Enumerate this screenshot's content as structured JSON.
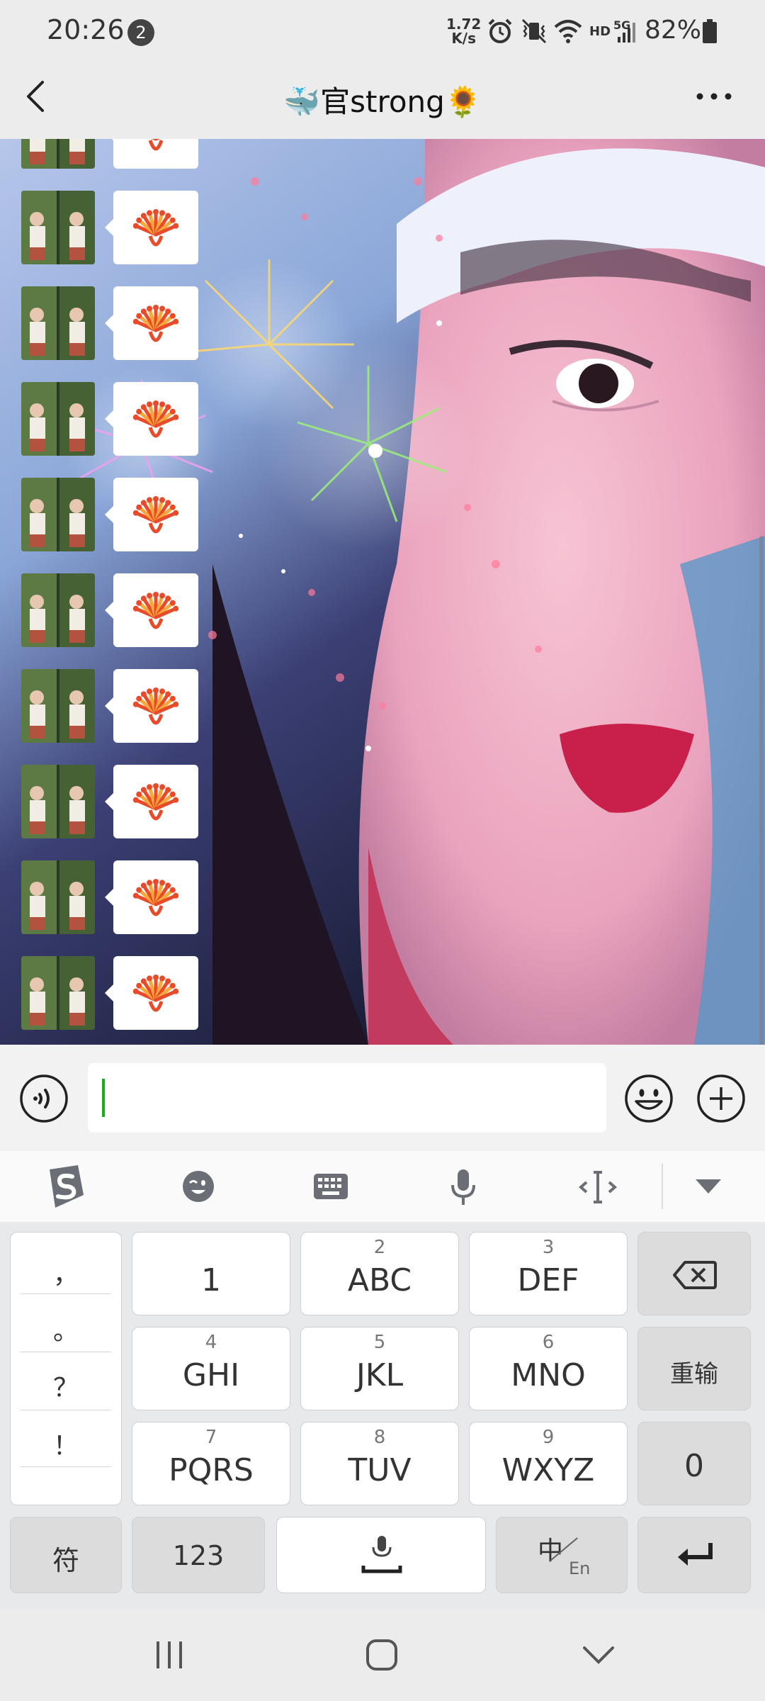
{
  "status_bar": {
    "time": "20:26",
    "notification_count": "2",
    "net_speed_value": "1.72",
    "net_speed_unit": "K/s",
    "hd_label": "HD",
    "fiveg_label": "5G",
    "battery": "82%"
  },
  "header": {
    "title": "🐳官strong🌻",
    "back_icon": "chevron-left-icon",
    "more_icon": "more-dots-icon"
  },
  "chat": {
    "messages": [
      {
        "sender": "contact",
        "content": "fireworks-emoji"
      },
      {
        "sender": "contact",
        "content": "fireworks-emoji"
      },
      {
        "sender": "contact",
        "content": "fireworks-emoji"
      },
      {
        "sender": "contact",
        "content": "fireworks-emoji"
      },
      {
        "sender": "contact",
        "content": "fireworks-emoji"
      },
      {
        "sender": "contact",
        "content": "fireworks-emoji"
      },
      {
        "sender": "contact",
        "content": "fireworks-emoji"
      },
      {
        "sender": "contact",
        "content": "fireworks-emoji"
      },
      {
        "sender": "contact",
        "content": "fireworks-emoji"
      },
      {
        "sender": "contact",
        "content": "fireworks-emoji"
      }
    ]
  },
  "input_bar": {
    "voice_icon": "voice-icon",
    "input_value": "",
    "emoji_icon": "smiley-icon",
    "plus_icon": "plus-icon"
  },
  "keyboard": {
    "toolbar_icons": [
      "sogou-logo-icon",
      "wink-emoji-icon",
      "keyboard-icon",
      "mic-icon",
      "cursor-move-icon",
      "collapse-icon"
    ],
    "punctuation": [
      "，",
      "。",
      "？",
      "！"
    ],
    "row1": [
      {
        "num": "",
        "label": "1"
      },
      {
        "num": "2",
        "label": "ABC"
      },
      {
        "num": "3",
        "label": "DEF"
      }
    ],
    "row2": [
      {
        "num": "4",
        "label": "GHI"
      },
      {
        "num": "5",
        "label": "JKL"
      },
      {
        "num": "6",
        "label": "MNO"
      }
    ],
    "row3": [
      {
        "num": "7",
        "label": "PQRS"
      },
      {
        "num": "8",
        "label": "TUV"
      },
      {
        "num": "9",
        "label": "WXYZ"
      }
    ],
    "reinput_label": "重输",
    "zero_label": "0",
    "symbols_label": "符",
    "numbers_label": "123",
    "lang_main": "中",
    "lang_sub": "En"
  },
  "colors": {
    "wechat_green": "#1aad19",
    "firework_red": "#e84a2a",
    "firework_orange": "#f6a93a"
  }
}
